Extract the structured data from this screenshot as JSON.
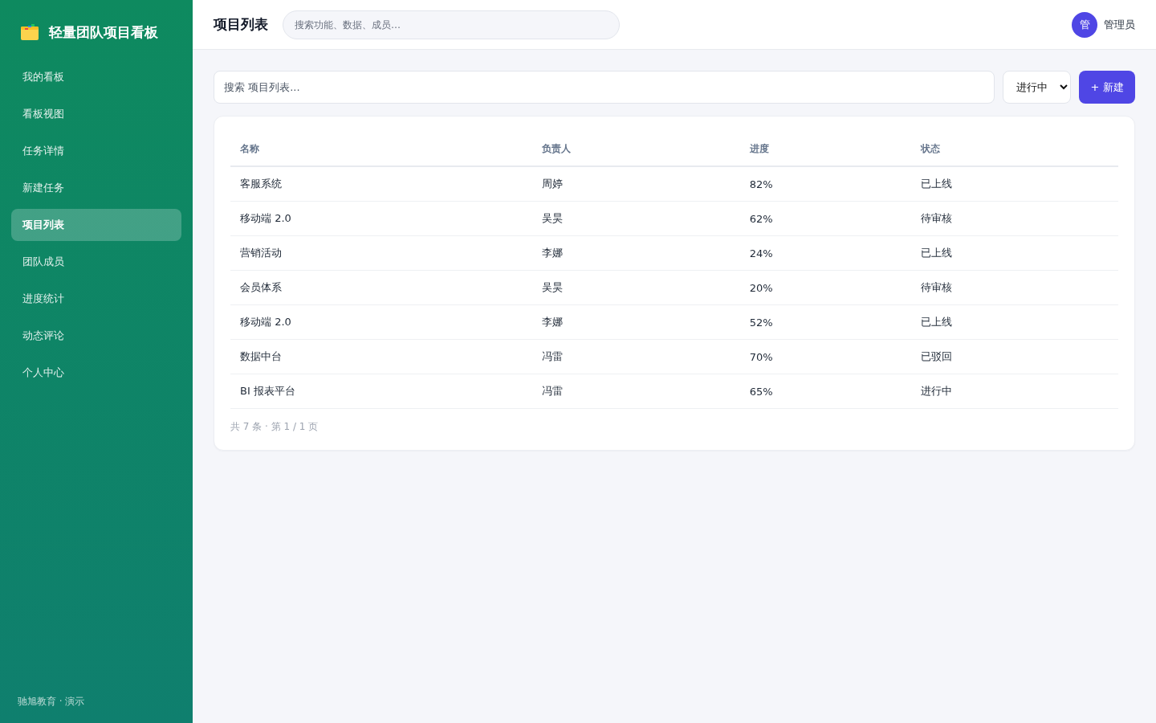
{
  "sidebar": {
    "brand": "轻量团队项目看板",
    "items": [
      {
        "label": "我的看板",
        "selected": false
      },
      {
        "label": "看板视图",
        "selected": false
      },
      {
        "label": "任务详情",
        "selected": false
      },
      {
        "label": "新建任务",
        "selected": false
      },
      {
        "label": "项目列表",
        "selected": true
      },
      {
        "label": "团队成员",
        "selected": false
      },
      {
        "label": "进度统计",
        "selected": false
      },
      {
        "label": "动态评论",
        "selected": false
      },
      {
        "label": "个人中心",
        "selected": false
      }
    ],
    "footer": "驰旭教育 · 演示"
  },
  "header": {
    "title": "项目列表",
    "search": {
      "placeholder": "搜索功能、数据、成员…"
    },
    "user": {
      "avatar": "管",
      "name": "管理员"
    }
  },
  "toolbar": {
    "search": {
      "placeholder": "搜索 项目列表..."
    },
    "status_filter": "进行中",
    "new_button": "+ 新建"
  },
  "table": {
    "columns": [
      "名称",
      "负责人",
      "进度",
      "状态"
    ],
    "rows": [
      {
        "name": "客服系统",
        "owner": "周婷",
        "progress": "82%",
        "status": "已上线"
      },
      {
        "name": "移动端 2.0",
        "owner": "吴昊",
        "progress": "62%",
        "status": "待审核"
      },
      {
        "name": "营销活动",
        "owner": "李娜",
        "progress": "24%",
        "status": "已上线"
      },
      {
        "name": "会员体系",
        "owner": "吴昊",
        "progress": "20%",
        "status": "待审核"
      },
      {
        "name": "移动端 2.0",
        "owner": "李娜",
        "progress": "52%",
        "status": "已上线"
      },
      {
        "name": "数据中台",
        "owner": "冯雷",
        "progress": "70%",
        "status": "已驳回"
      },
      {
        "name": "BI 报表平台",
        "owner": "冯雷",
        "progress": "65%",
        "status": "进行中"
      }
    ],
    "pagination": "共 7 条 · 第 1 / 1 页"
  }
}
